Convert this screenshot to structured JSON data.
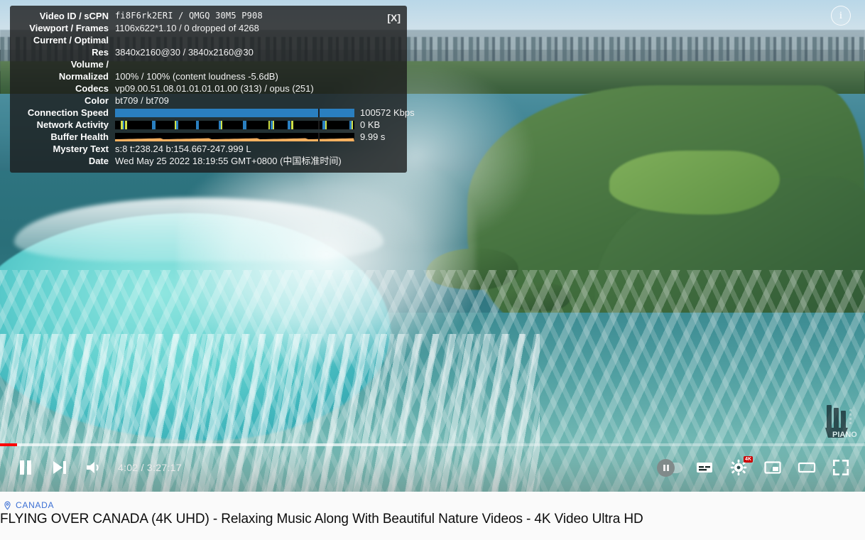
{
  "stats": {
    "close_label": "[X]",
    "rows": [
      {
        "label": "Video ID / sCPN",
        "value": "fi8F6rk2ERI / QMGQ 30M5 P908",
        "mono": true
      },
      {
        "label": "Viewport / Frames",
        "value": "1106x622*1.10 / 0 dropped of 4268",
        "mono": false
      },
      {
        "label": "Current / Optimal",
        "value": "",
        "mono": false
      },
      {
        "label": "Res",
        "value": "3840x2160@30 / 3840x2160@30",
        "mono": false
      },
      {
        "label": "Volume /",
        "value": "",
        "mono": false
      },
      {
        "label": "Normalized",
        "value": "100% / 100% (content loudness -5.6dB)",
        "mono": false
      },
      {
        "label": "Codecs",
        "value": "vp09.00.51.08.01.01.01.01.00 (313) / opus (251)",
        "mono": false
      },
      {
        "label": "Color",
        "value": "bt709 / bt709",
        "mono": false
      }
    ],
    "connection_speed": {
      "label": "Connection Speed",
      "value": "100572 Kbps",
      "color": "#2a7fc0"
    },
    "network_activity": {
      "label": "Network Activity",
      "value": "0 KB",
      "color": "#2a7fc0",
      "accent": "#cfe14a"
    },
    "buffer_health": {
      "label": "Buffer Health",
      "value": "9.99 s",
      "color": "#f8b160"
    },
    "mystery": {
      "label": "Mystery Text",
      "value": "s:8 t:238.24 b:154.667-247.999 L"
    },
    "date": {
      "label": "Date",
      "value": "Wed May 25 2022 18:19:55 GMT+0800 (中国标准时间)"
    }
  },
  "player": {
    "info_icon": "info-icon",
    "progress": {
      "played_percent": 1.95,
      "loaded_percent": 47.0,
      "played_color": "#ff0000"
    },
    "controls_left": [
      {
        "name": "pause-button",
        "icon": "pause-icon"
      },
      {
        "name": "next-video-button",
        "icon": "next-icon"
      },
      {
        "name": "volume-button",
        "icon": "volume-icon"
      }
    ],
    "time_label": "4:02 / 3:27:17",
    "current_time": "4:02",
    "duration": "3:27:17",
    "controls_right": [
      {
        "name": "autoplay-toggle",
        "icon": "autoplay-toggle-icon",
        "state": "paused"
      },
      {
        "name": "subtitles-button",
        "icon": "subtitles-icon"
      },
      {
        "name": "settings-button",
        "icon": "gear-icon",
        "badge": "4K"
      },
      {
        "name": "miniplayer-button",
        "icon": "miniplayer-icon"
      },
      {
        "name": "theater-button",
        "icon": "theater-icon"
      },
      {
        "name": "fullscreen-button",
        "icon": "fullscreen-icon"
      }
    ],
    "watermark": "piano-logo-watermark"
  },
  "meta": {
    "location_tag": "CANADA",
    "location_icon": "map-pin-icon",
    "title": "FLYING OVER CANADA (4K UHD) - Relaxing Music Along With Beautiful Nature Videos - 4K Video Ultra HD"
  }
}
